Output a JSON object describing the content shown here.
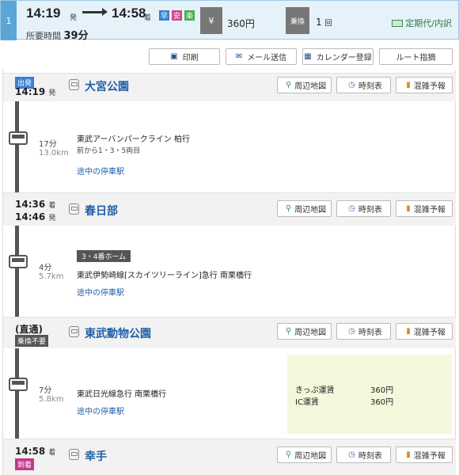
{
  "route": {
    "number": "1",
    "depart_time": "14:19",
    "depart_suffix": "発",
    "arrive_time": "14:58",
    "arrive_suffix": "着",
    "tags": [
      {
        "char": "早",
        "color": "#3b7fd1"
      },
      {
        "char": "安",
        "color": "#d24a8c"
      },
      {
        "char": "楽",
        "color": "#49b04b"
      }
    ],
    "duration_label": "所要時間",
    "duration_value": "39分",
    "fare_icon": "¥",
    "fare": "360円",
    "transfer_icon": "乗換",
    "transfers": "1",
    "transfers_unit": "回",
    "teiki_label": "定期代/内訳"
  },
  "actions": {
    "print": "印刷",
    "mail": "メール送信",
    "calendar": "カレンダー登録",
    "route_guide": "ルート指摘"
  },
  "station_buttons": {
    "map": "周辺地図",
    "timetable": "時刻表",
    "congestion": "混雑予報"
  },
  "stations": [
    {
      "name": "大宮公園",
      "label": "出発",
      "time1": "14:19",
      "suf1": "発"
    },
    {
      "name": "春日部",
      "time1": "14:36",
      "suf1": "着",
      "time2": "14:46",
      "suf2": "発"
    },
    {
      "name": "東武動物公園",
      "direct": "(直通)",
      "label": "乗換不要"
    },
    {
      "name": "幸手",
      "label": "到着",
      "time1": "14:58",
      "suf1": "着"
    }
  ],
  "segments": [
    {
      "minutes": "17分",
      "distance": "13.0km",
      "line": "東武アーバンパークライン 柏行",
      "car": "前から1・3・5両目",
      "stops": "途中の停車駅"
    },
    {
      "platform": "3・4番ホーム",
      "minutes": "4分",
      "distance": "5.7km",
      "line": "東武伊勢崎線[スカイツリーライン]急行 南栗橋行",
      "stops": "途中の停車駅"
    },
    {
      "minutes": "7分",
      "distance": "5.8km",
      "line": "東武日光線急行 南栗橋行",
      "stops": "途中の停車駅"
    }
  ],
  "fare_detail": {
    "ticket_label": "きっぷ運賃",
    "ticket_value": "360円",
    "ic_label": "IC運賃",
    "ic_value": "360円"
  }
}
